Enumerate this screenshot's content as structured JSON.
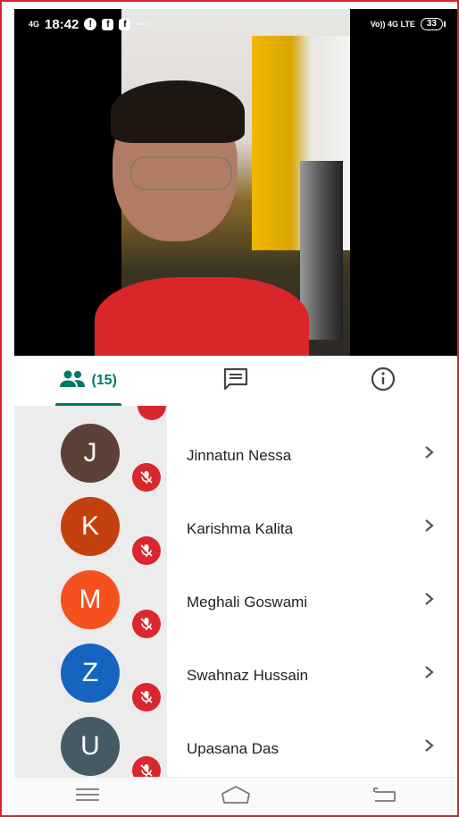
{
  "status_bar": {
    "network": "4G",
    "time": "18:42",
    "more": "···",
    "right_indicators": "Vo)) 4G LTE",
    "battery": "33"
  },
  "tabs": {
    "participants_count": "(15)",
    "active": "participants"
  },
  "colors": {
    "accent": "#00796b",
    "mute": "#d9272d",
    "frame": "#d9232b"
  },
  "participants": [
    {
      "initial": "J",
      "name": "Jinnatun Nessa",
      "color": "#5d4037",
      "muted": true
    },
    {
      "initial": "K",
      "name": "Karishma Kalita",
      "color": "#c4410f",
      "muted": true
    },
    {
      "initial": "M",
      "name": "Meghali Goswami",
      "color": "#f4511e",
      "muted": true
    },
    {
      "initial": "Z",
      "name": "Swahnaz Hussain",
      "color": "#1565c0",
      "muted": true
    },
    {
      "initial": "U",
      "name": "Upasana Das",
      "color": "#455a64",
      "muted": true
    }
  ],
  "icons": {
    "participants": "people-icon",
    "chat": "chat-icon",
    "info": "info-icon",
    "mic_off": "mic-off-icon",
    "chevron": "chevron-right-icon",
    "nav": [
      "menu-icon",
      "home-icon",
      "back-icon"
    ]
  }
}
